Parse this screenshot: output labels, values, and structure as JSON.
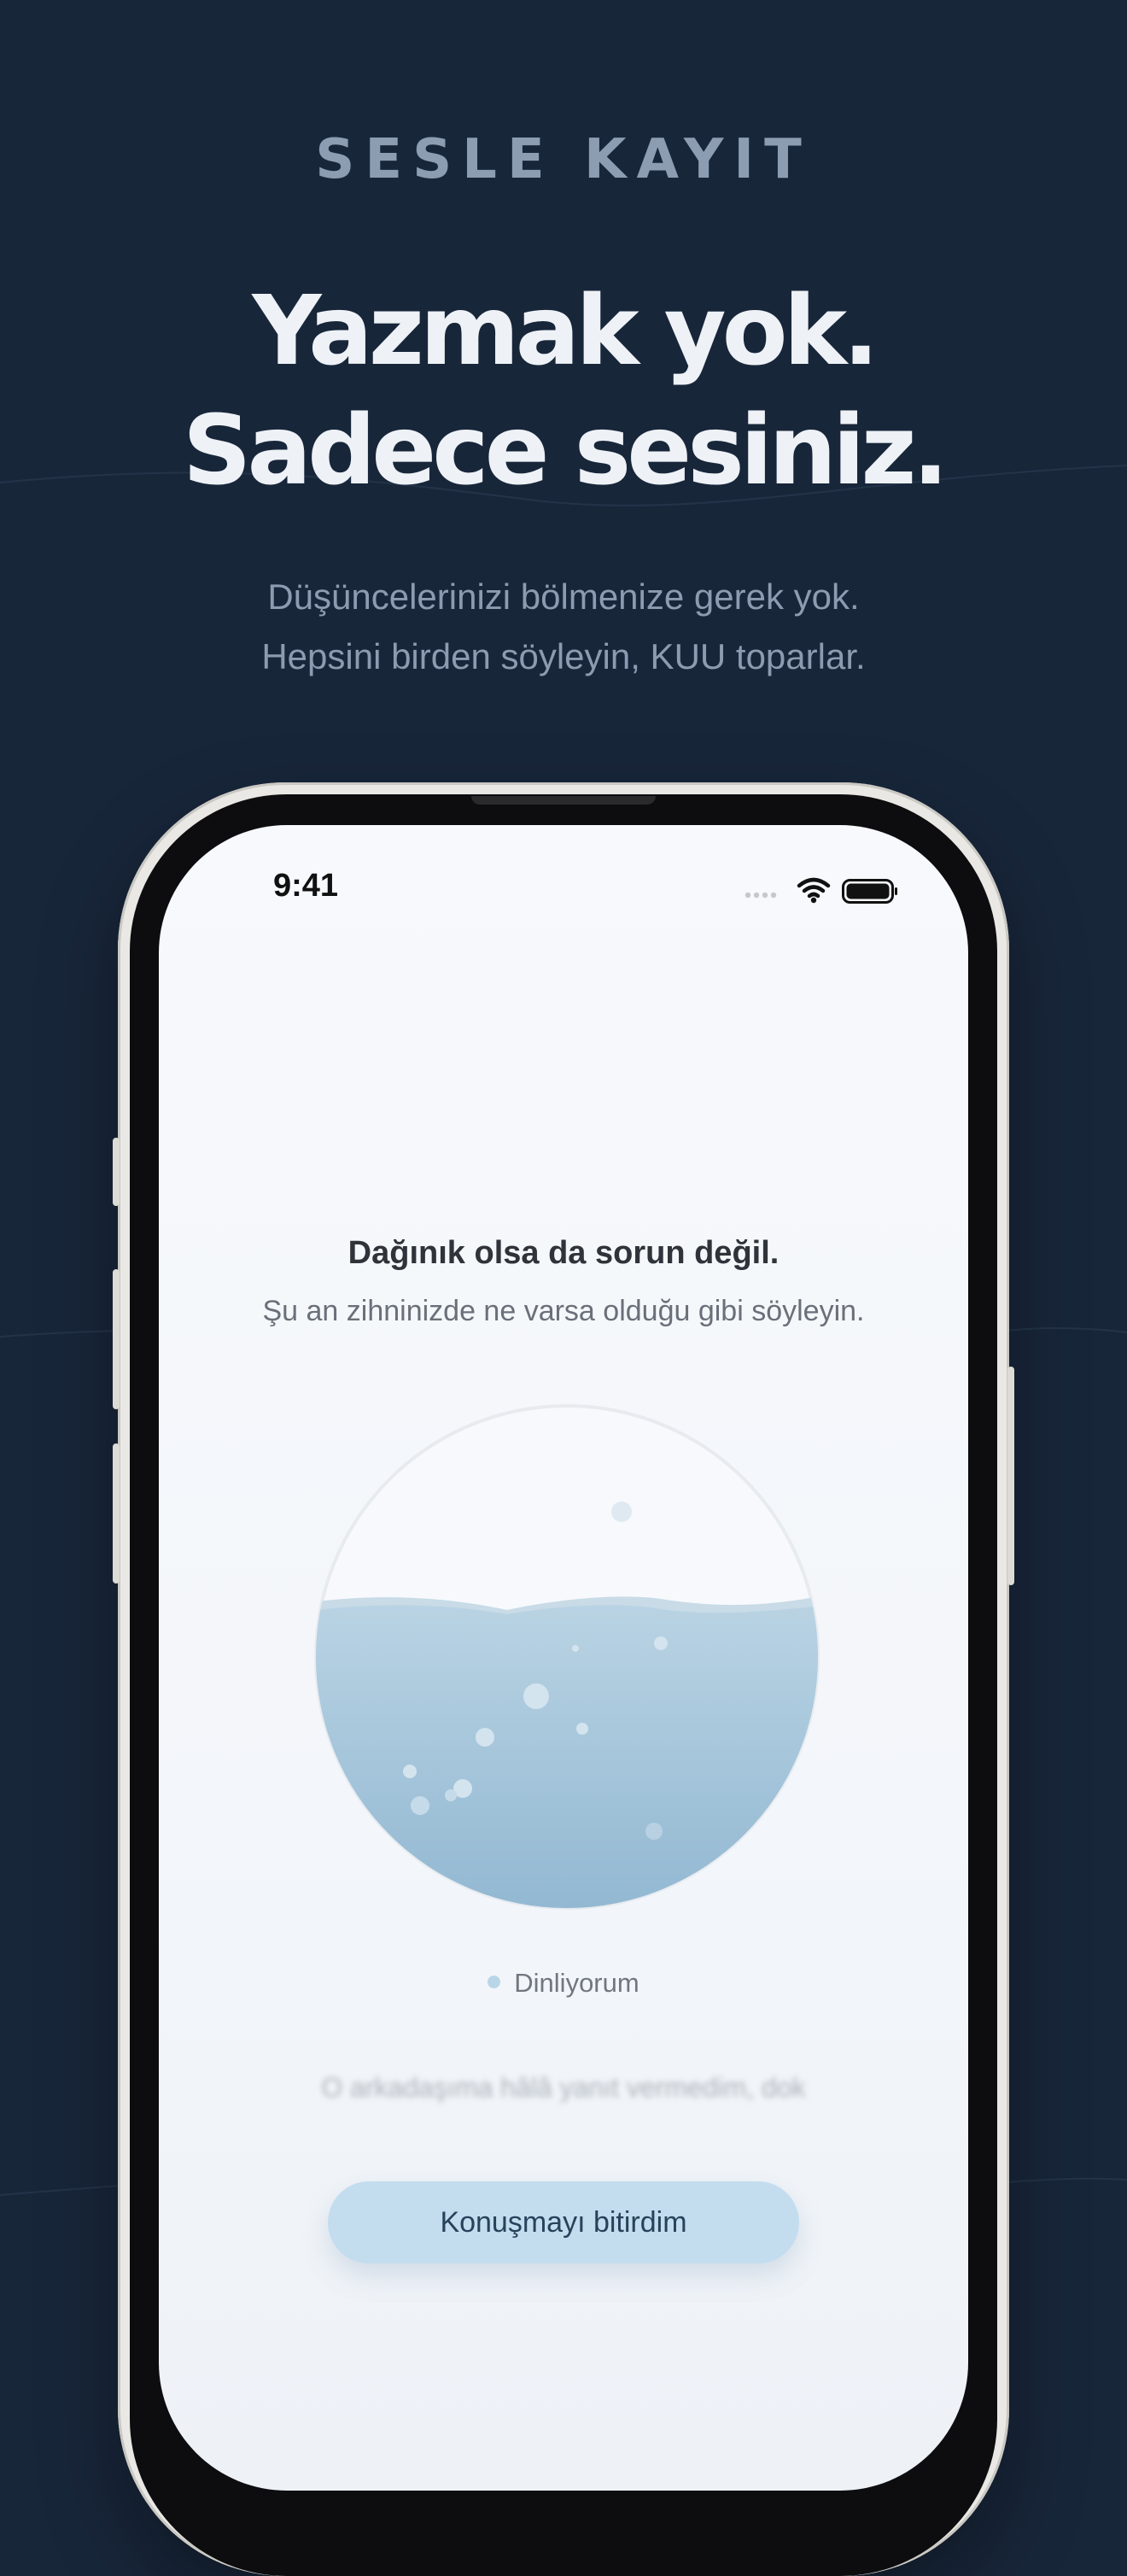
{
  "header": {
    "eyebrow": "SESLE KAYIT",
    "headline_line1": "Yazmak yok.",
    "headline_line2": "Sadece sesiniz.",
    "subtitle_line1": "Düşüncelerinizi bölmenize gerek yok.",
    "subtitle_line2": "Hepsini birden söyleyin, KUU toparlar."
  },
  "phone": {
    "status": {
      "time": "9:41",
      "icons": [
        "signal-icon",
        "wifi-icon",
        "battery-icon"
      ]
    },
    "prompt": {
      "title": "Dağınık olsa da sorun değil.",
      "subtitle": "Şu an zihninizde ne varsa olduğu gibi söyleyin."
    },
    "listening_label": "Dinliyorum",
    "live_transcript": "O arkadaşıma hâlâ yanıt vermedim, dok",
    "finish_button": "Konuşmayı bitirdim"
  },
  "colors": {
    "background": "#18263a",
    "headline": "#eef2f7",
    "muted": "#8d9db1",
    "water": "#a8c8dc",
    "button": "#c3ddef"
  }
}
